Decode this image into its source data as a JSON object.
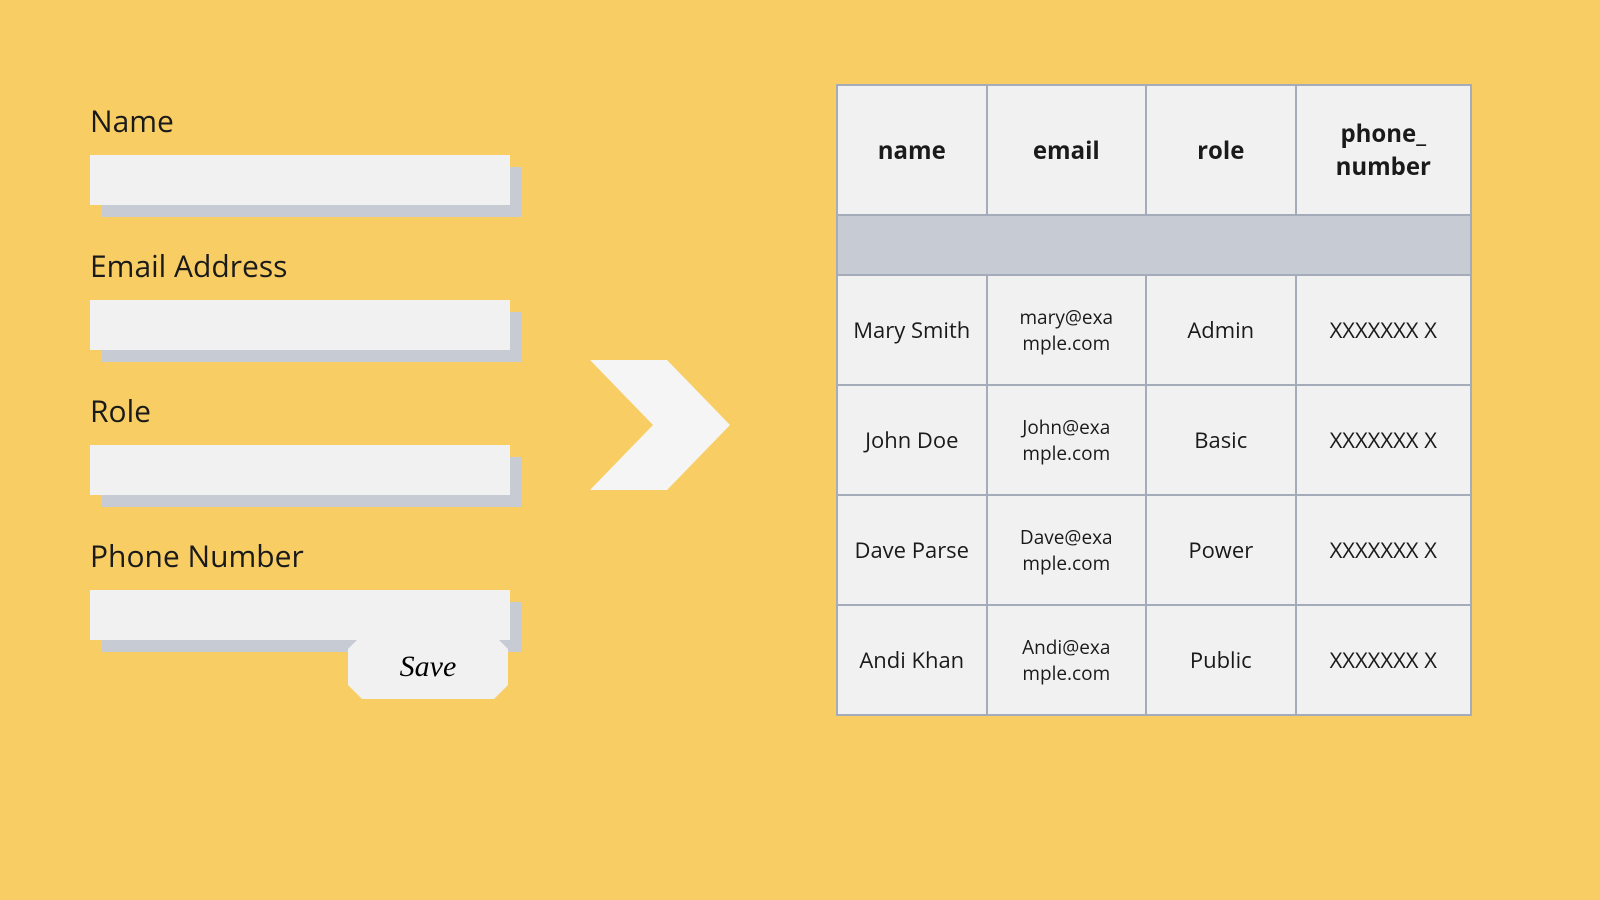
{
  "form": {
    "fields": [
      {
        "label": "Name",
        "value": ""
      },
      {
        "label": "Email Address",
        "value": ""
      },
      {
        "label": "Role",
        "value": ""
      },
      {
        "label": "Phone Number",
        "value": ""
      }
    ],
    "save_label": "Save"
  },
  "table": {
    "headers": [
      "name",
      "email",
      "role",
      "phone_number"
    ],
    "header_display": [
      "name",
      "email",
      "role",
      "phone_ number"
    ],
    "rows": [
      {
        "name": "Mary Smith",
        "email": "mary@example.com",
        "role": "Admin",
        "phone_number": "XXXXXXXX"
      },
      {
        "name": "John Doe",
        "email": "John@example.com",
        "role": "Basic",
        "phone_number": "XXXXXXXX"
      },
      {
        "name": "Dave Parse",
        "email": "Dave@example.com",
        "role": "Power",
        "phone_number": "XXXXXXXX"
      },
      {
        "name": "Andi Khan",
        "email": "Andi@example.com",
        "role": "Public",
        "phone_number": "XXXXXXXX"
      }
    ],
    "display": {
      "emails": [
        "mary@exa mple.com",
        "John@exa mple.com",
        "Dave@exa mple.com",
        "Andi@exa mple.com"
      ],
      "phones": [
        "XXXXXXX X",
        "XXXXXXX X",
        "XXXXXXX X",
        "XXXXXXX X"
      ]
    }
  }
}
